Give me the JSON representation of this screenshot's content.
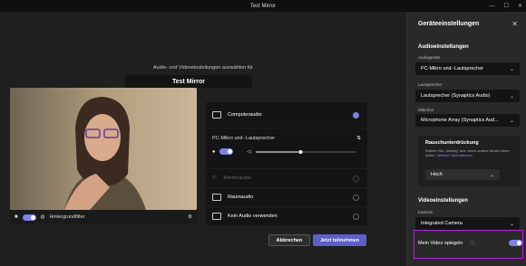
{
  "window": {
    "title": "Test Mirror"
  },
  "main": {
    "subtitle": "Audio- und Videoeinstellungen auswählen für",
    "meeting_name": "Test Mirror",
    "bg_filter": "Hintergrundfilter",
    "audio": {
      "computer_audio": "Computeraudio",
      "device": "PC-Mikro und -Lautsprecher",
      "phone_audio": "Telefonaudio",
      "room_audio": "Raumaudio",
      "no_audio": "Kein Audio verwenden",
      "volume": 0.45
    },
    "cancel": "Abbrechen",
    "join": "Jetzt teilnehmen"
  },
  "side": {
    "title": "Geräteeinstellungen",
    "audio_section": "Audioeinstellungen",
    "audio_device_label": "Audiogeräte",
    "audio_device": "PC-Mikro und -Lautsprecher",
    "speaker_label": "Lautsprecher",
    "speaker": "Lautsprecher (Synaptics Audio)",
    "mic_label": "Mikrofon",
    "mic": "Microphone Array (Synaptics Aud...",
    "noise_title": "Rauschunterdrückung",
    "noise_desc": "Wählen Sie „Niedrig“ aus, wenn andere Musik hören sollen.",
    "noise_link": "Weitere Informationen",
    "noise_value": "Hoch",
    "video_section": "Videoeinstellungen",
    "camera_label": "Kamera",
    "camera": "Integrated Camera",
    "mirror_label": "Mein Video spiegeln"
  }
}
